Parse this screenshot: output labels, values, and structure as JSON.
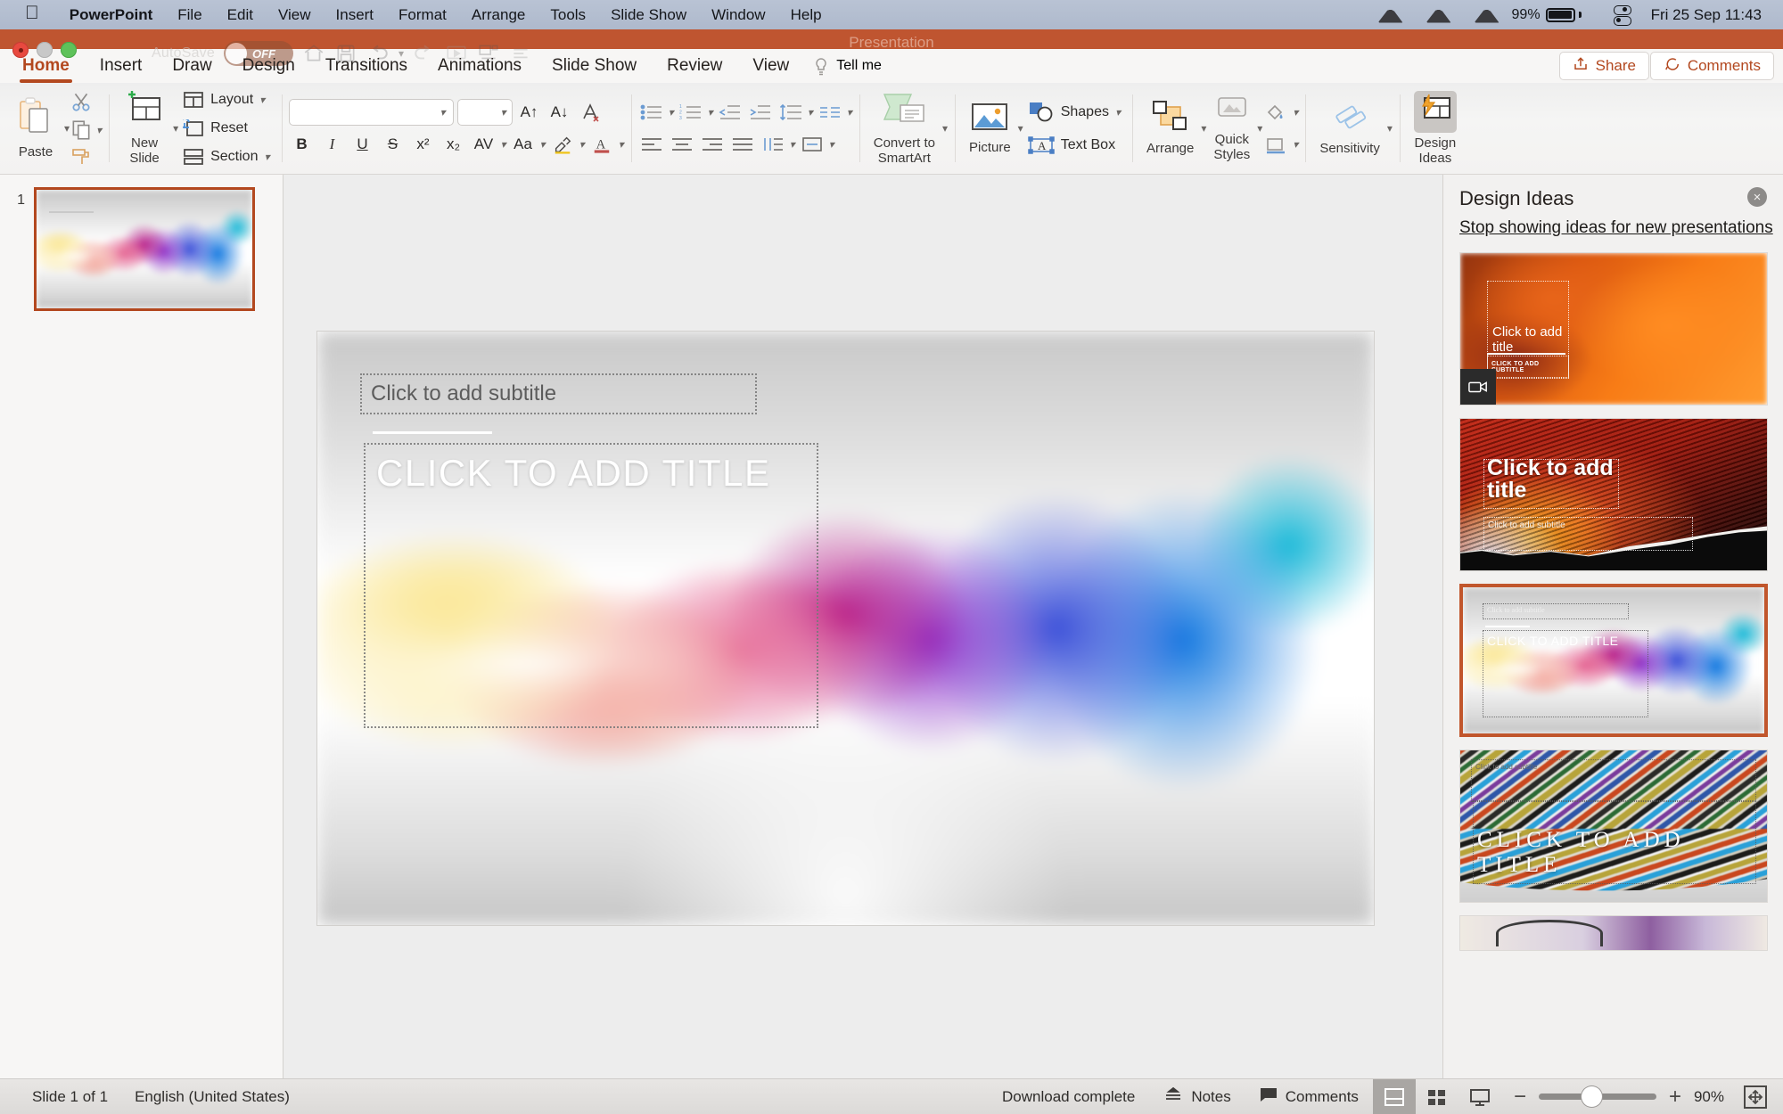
{
  "menubar": {
    "apple": "apple-logo",
    "items": [
      {
        "label": "PowerPoint",
        "bold": true
      },
      {
        "label": "File",
        "bold": false
      },
      {
        "label": "Edit",
        "bold": false
      },
      {
        "label": "View",
        "bold": false
      },
      {
        "label": "Insert",
        "bold": false
      },
      {
        "label": "Format",
        "bold": false
      },
      {
        "label": "Arrange",
        "bold": false
      },
      {
        "label": "Tools",
        "bold": false
      },
      {
        "label": "Slide Show",
        "bold": false
      },
      {
        "label": "Window",
        "bold": false
      },
      {
        "label": "Help",
        "bold": false
      }
    ],
    "battery_percent": "99%",
    "clock": "Fri 25 Sep  11:43"
  },
  "window": {
    "title": "Presentation",
    "autosave_label": "AutoSave",
    "autosave_state": "OFF"
  },
  "tabs": [
    {
      "label": "Home",
      "active": true
    },
    {
      "label": "Insert",
      "active": false
    },
    {
      "label": "Draw",
      "active": false
    },
    {
      "label": "Design",
      "active": false
    },
    {
      "label": "Transitions",
      "active": false
    },
    {
      "label": "Animations",
      "active": false
    },
    {
      "label": "Slide Show",
      "active": false
    },
    {
      "label": "Review",
      "active": false
    },
    {
      "label": "View",
      "active": false
    }
  ],
  "tellme": "Tell me",
  "share_label": "Share",
  "comments_label": "Comments",
  "ribbon": {
    "paste": "Paste",
    "new_slide": "New\nSlide",
    "new_slide_line1": "New",
    "new_slide_line2": "Slide",
    "layout": "Layout",
    "reset": "Reset",
    "section": "Section",
    "font_name": "",
    "font_size": "",
    "bold": "B",
    "italic": "I",
    "underline": "U",
    "strikethrough": "S",
    "superscript": "x²",
    "subscript": "x₂",
    "char_spacing": "AV",
    "change_case": "Aa",
    "text_highlight": "A",
    "font_color": "A",
    "convert_to_smartart_l1": "Convert to",
    "convert_to_smartart_l2": "SmartArt",
    "picture": "Picture",
    "shapes": "Shapes",
    "text_box": "Text Box",
    "arrange": "Arrange",
    "quick_styles_l1": "Quick",
    "quick_styles_l2": "Styles",
    "sensitivity": "Sensitivity",
    "design_ideas_l1": "Design",
    "design_ideas_l2": "Ideas"
  },
  "thumbnails": [
    {
      "number": "1",
      "selected": true
    }
  ],
  "slide": {
    "subtitle_placeholder": "Click to add subtitle",
    "title_placeholder": "CLICK TO ADD TITLE"
  },
  "design_ideas": {
    "heading": "Design Ideas",
    "stop_link": "Stop showing ideas for new presentations",
    "close": "×",
    "items": [
      {
        "id": "idea-orange-smoke",
        "title": "Click to add title",
        "subtitle": "CLICK TO ADD SUBTITLE",
        "selected": false,
        "has_video_badge": true
      },
      {
        "id": "idea-red-fibers",
        "title": "Click to add title",
        "subtitle": "Click to add subtitle",
        "selected": false,
        "has_video_badge": false
      },
      {
        "id": "idea-rainbow-gradient",
        "title": "CLICK TO ADD TITLE",
        "subtitle": "Click to add subtitle",
        "selected": true,
        "has_video_badge": false
      },
      {
        "id": "idea-color-ribbons",
        "title": "CLICK TO ADD TITLE",
        "subtitle": "Click to add subtitle",
        "selected": false,
        "has_video_badge": false
      }
    ]
  },
  "statusbar": {
    "slide_count": "Slide 1 of 1",
    "language": "English (United States)",
    "download_status": "Download complete",
    "notes": "Notes",
    "comments": "Comments",
    "zoom_out": "−",
    "zoom_in": "+",
    "zoom_level": "90%"
  },
  "colors": {
    "accent": "#b3481f",
    "titlebar": "#bf5530",
    "selection": "#c1562c"
  }
}
